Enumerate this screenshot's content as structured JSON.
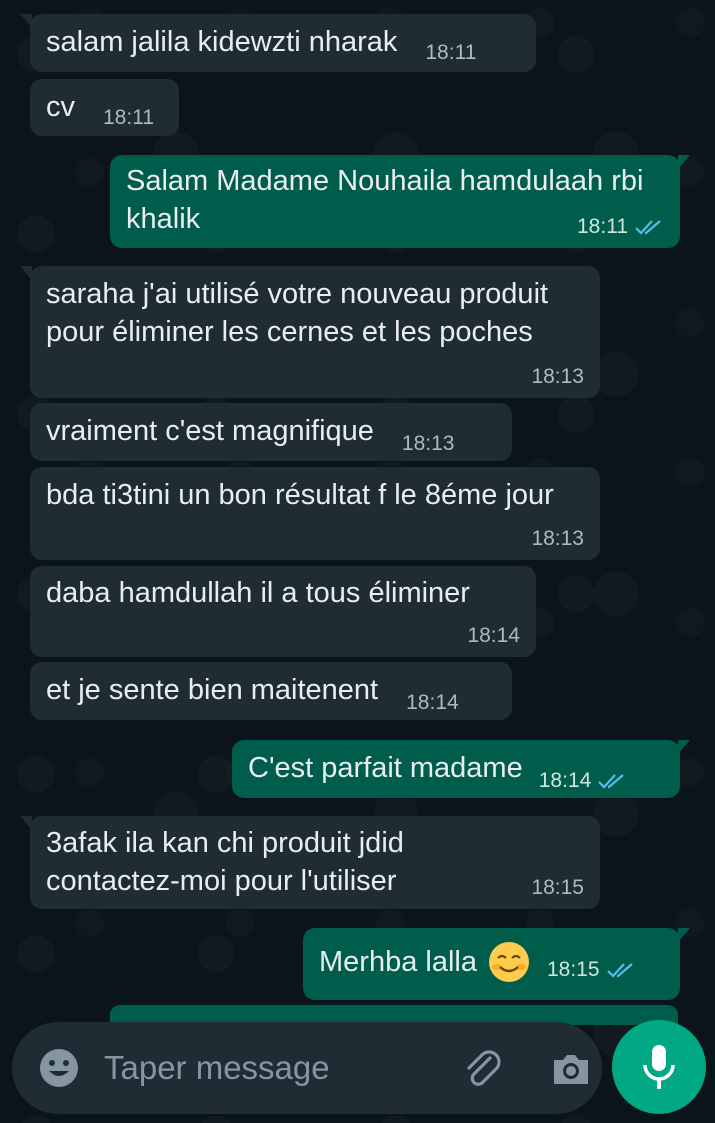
{
  "messages": [
    {
      "dir": "in",
      "text": "salam jalila kidewzti nharak",
      "time": "18:11"
    },
    {
      "dir": "in",
      "text": "cv",
      "time": "18:11"
    },
    {
      "dir": "out",
      "text": "Salam Madame Nouhaila hamdulaah rbi khalik",
      "time": "18:11",
      "status": "read"
    },
    {
      "dir": "in",
      "text": "saraha j'ai utilisé votre nouveau produit pour éliminer les cernes et les poches",
      "time": "18:13"
    },
    {
      "dir": "in",
      "text": "vraiment c'est magnifique",
      "time": "18:13"
    },
    {
      "dir": "in",
      "text": "bda ti3tini un bon résultat f le 8éme jour",
      "time": "18:13"
    },
    {
      "dir": "in",
      "text": "daba hamdullah il a tous éliminer",
      "time": "18:14"
    },
    {
      "dir": "in",
      "text": "et je sente bien maitenent",
      "time": "18:14"
    },
    {
      "dir": "out",
      "text": "C'est parfait madame",
      "time": "18:14",
      "status": "read"
    },
    {
      "dir": "in",
      "text": "3afak ila kan chi produit jdid contactez-moi pour l'utiliser",
      "time": "18:15"
    },
    {
      "dir": "out",
      "text": "Merhba lalla",
      "emoji": "smiling-face-emoji",
      "time": "18:15",
      "status": "read"
    }
  ],
  "composer": {
    "placeholder": "Taper message",
    "icons": [
      "emoji-icon",
      "attachment-icon",
      "camera-icon",
      "microphone-icon"
    ]
  },
  "colors": {
    "background": "#0b141a",
    "incoming": "#202c33",
    "outgoing": "#005c4b",
    "read_ticks": "#53bdeb",
    "accent": "#00a884"
  }
}
